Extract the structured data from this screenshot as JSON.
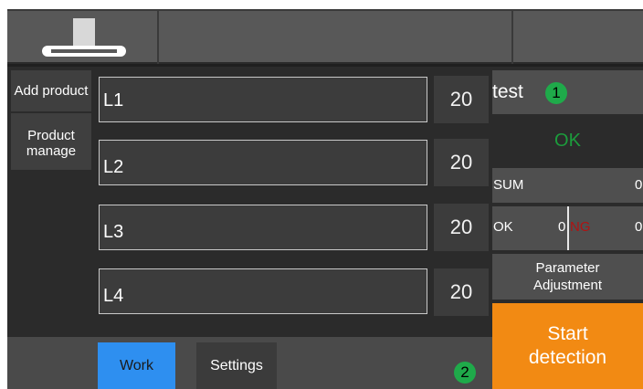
{
  "colors": {
    "accent_blue": "#2e8ff0",
    "start_orange": "#f28a13",
    "ok_green": "#1c9c3c",
    "ng_red": "#b01212",
    "badge_green": "#1faa4a"
  },
  "header": {
    "logo_icon": "conveyor-logo-icon"
  },
  "sidebar": {
    "add_product": "Add product",
    "product_manage": "Product manage"
  },
  "products": [
    {
      "label": "L1",
      "count": "20"
    },
    {
      "label": "L2",
      "count": "20"
    },
    {
      "label": "L3",
      "count": "20"
    },
    {
      "label": "L4",
      "count": "20"
    }
  ],
  "right_panel": {
    "test_name": "test",
    "badge1": "1",
    "status": "OK",
    "sum_label": "SUM",
    "sum_value": "0",
    "ok_label": "OK",
    "ok_value": "0",
    "ng_label": "NG",
    "ng_value": "0",
    "parameter_adjustment": "Parameter Adjustment",
    "start_detection": "Start detection"
  },
  "bottom_bar": {
    "tabs": [
      {
        "label": "Work",
        "active": true
      },
      {
        "label": "Settings",
        "active": false
      }
    ],
    "badge2": "2"
  }
}
